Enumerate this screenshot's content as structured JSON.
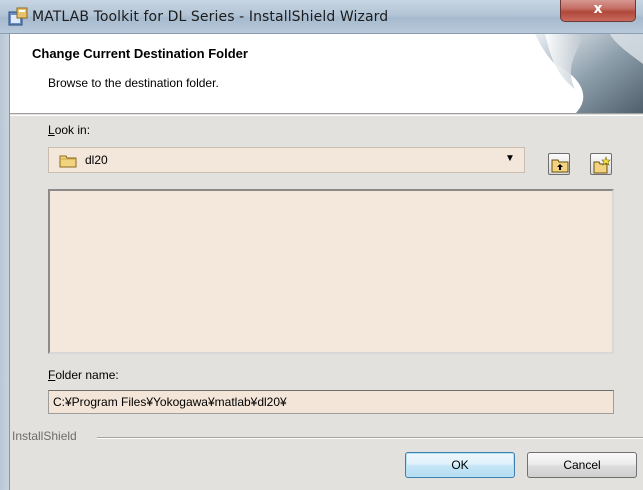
{
  "window": {
    "title": "MATLAB Toolkit for DL Series - InstallShield Wizard",
    "close_label": "x"
  },
  "header": {
    "title": "Change Current Destination Folder",
    "subtitle": "Browse to the destination folder."
  },
  "look_in": {
    "label_accel": "L",
    "label_rest": "ook in:",
    "value": "dl20"
  },
  "toolbar": {
    "up_icon": "folder-up-icon",
    "new_icon": "new-folder-icon"
  },
  "folder_name": {
    "label_accel": "F",
    "label_rest": "older name:",
    "value": "C:¥Program Files¥Yokogawa¥matlab¥dl20¥"
  },
  "footer": {
    "brand": "InstallShield",
    "ok_label": "OK",
    "cancel_label": "Cancel"
  },
  "colors": {
    "field_bg": "#f3e6da",
    "titlebar": "#b2c4d6",
    "close": "#c56f65"
  }
}
